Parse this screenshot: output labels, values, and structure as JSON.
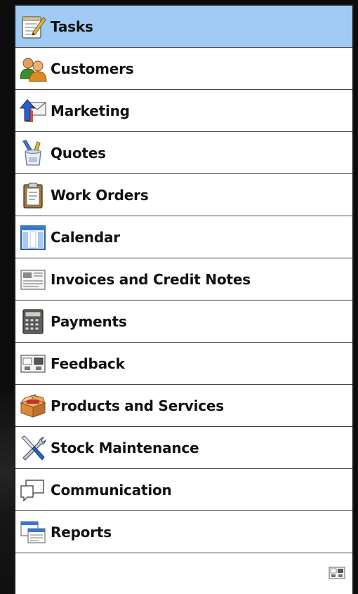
{
  "navigation": {
    "items": [
      {
        "label": "Tasks",
        "icon": "notepad-pencil-icon",
        "selected": true
      },
      {
        "label": "Customers",
        "icon": "people-icon",
        "selected": false
      },
      {
        "label": "Marketing",
        "icon": "envelope-arrow-icon",
        "selected": false
      },
      {
        "label": "Quotes",
        "icon": "pencil-cup-icon",
        "selected": false
      },
      {
        "label": "Work Orders",
        "icon": "clipboard-icon",
        "selected": false
      },
      {
        "label": "Calendar",
        "icon": "calendar-icon",
        "selected": false
      },
      {
        "label": "Invoices and Credit Notes",
        "icon": "newspaper-icon",
        "selected": false
      },
      {
        "label": "Payments",
        "icon": "calculator-icon",
        "selected": false
      },
      {
        "label": "Feedback",
        "icon": "feedback-panel-icon",
        "selected": false
      },
      {
        "label": "Products and Services",
        "icon": "open-box-icon",
        "selected": false
      },
      {
        "label": "Stock Maintenance",
        "icon": "wrench-screwdriver-icon",
        "selected": false
      },
      {
        "label": "Communication",
        "icon": "speech-bubbles-icon",
        "selected": false
      },
      {
        "label": "Reports",
        "icon": "report-windows-icon",
        "selected": false
      }
    ]
  },
  "colors": {
    "selected_bg": "#9fcbf5",
    "panel_bg": "#ffffff",
    "outer_bg": "#0c0c0c"
  },
  "footer": {
    "icon": "configure-pane-icon"
  }
}
